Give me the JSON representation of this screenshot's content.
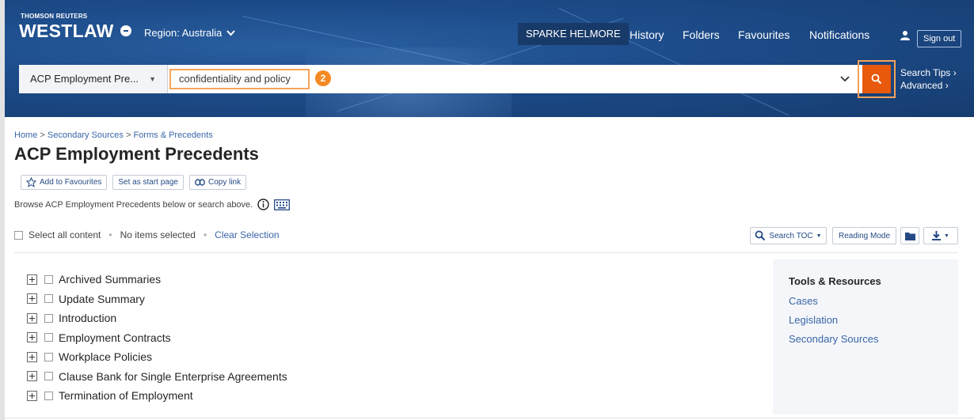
{
  "header": {
    "brand_top": "THOMSON REUTERS",
    "brand": "WESTLAW",
    "region": "Region: Australia",
    "org": "SPARKE HELMORE",
    "nav": [
      "History",
      "Folders",
      "Favourites",
      "Notifications"
    ],
    "sign_out": "Sign out"
  },
  "search": {
    "scope": "ACP Employment Pre...",
    "query": "confidentiality and policy",
    "step_badge": "2",
    "tips": "Search Tips",
    "advanced": "Advanced"
  },
  "page": {
    "breadcrumb": [
      "Home",
      "Secondary Sources",
      "Forms & Precedents"
    ],
    "title": "ACP Employment Precedents",
    "buttons": {
      "add_fav": "Add to Favourites",
      "start_page": "Set as start page",
      "copy_link": "Copy link"
    },
    "browse_text": "Browse ACP Employment Precedents below or search above."
  },
  "selection": {
    "select_all": "Select all content",
    "none_selected": "No items selected",
    "clear": "Clear Selection"
  },
  "toolbar": {
    "search_toc": "Search TOC",
    "reading_mode": "Reading Mode"
  },
  "toc": [
    "Archived Summaries",
    "Update Summary",
    "Introduction",
    "Employment Contracts",
    "Workplace Policies",
    "Clause Bank for Single Enterprise Agreements",
    "Termination of Employment"
  ],
  "sidebar": {
    "title": "Tools & Resources",
    "links": [
      "Cases",
      "Legislation",
      "Secondary Sources"
    ]
  },
  "colors": {
    "header_blue": "#1d4c8a",
    "accent_orange": "#e8590c",
    "highlight_orange": "#f5a35a",
    "link_blue": "#3a66a8"
  }
}
